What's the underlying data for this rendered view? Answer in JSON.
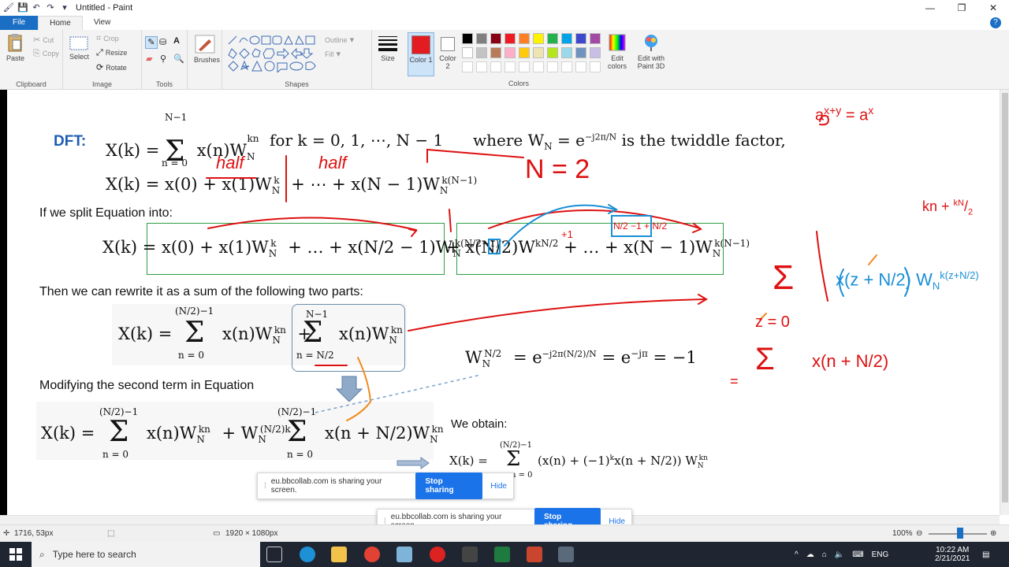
{
  "window": {
    "title": "Untitled - Paint"
  },
  "tabs": {
    "file": "File",
    "home": "Home",
    "view": "View"
  },
  "ribbon": {
    "clipboard": {
      "paste": "Paste",
      "cut": "Cut",
      "copy": "Copy",
      "label": "Clipboard"
    },
    "image": {
      "select": "Select",
      "crop": "Crop",
      "resize": "Resize",
      "rotate": "Rotate",
      "label": "Image"
    },
    "tools": {
      "label": "Tools"
    },
    "brushes": {
      "label": "Brushes"
    },
    "shapes": {
      "outline": "Outline",
      "fill": "Fill",
      "label": "Shapes"
    },
    "size": {
      "label": "Size"
    },
    "color1": {
      "label": "Color 1",
      "value": "#e31b23"
    },
    "color2": {
      "label": "Color 2",
      "value": "#ffffff"
    },
    "colors": {
      "label": "Colors"
    },
    "edit_colors": "Edit colors",
    "paint3d": "Edit with Paint 3D",
    "palette": [
      "#000000",
      "#7f7f7f",
      "#880015",
      "#ed1c24",
      "#ff7f27",
      "#fff200",
      "#22b14c",
      "#00a2e8",
      "#3f48cc",
      "#a349a4",
      "#ffffff",
      "#c3c3c3",
      "#b97a57",
      "#ffaec9",
      "#ffc90e",
      "#efe4b0",
      "#b5e61d",
      "#99d9ea",
      "#7092be",
      "#c8bfe7"
    ]
  },
  "content": {
    "dft_label": "DFT:",
    "eq1": "X(k) = Σ x(n)W",
    "eq1_sum_top": "N−1",
    "eq1_sum_bottom": "n = 0",
    "eq1_for": "for   k = 0, 1, ⋯, N − 1",
    "eq1_where": "where W",
    "eq1_twiddle": "is the twiddle factor,",
    "eq2": "X(k) = x(0) + x(1)W",
    "eq2_rest": "+ ⋯ + x(N − 1)W",
    "split_text": "If we split Equation into:",
    "eq3_left": "X(k) = x(0) + x(1)W",
    "eq3_mid": "+ … + x",
    "eq3_right": "+ x",
    "eq3_right2": "W",
    "eq3_right3": "+ … + x(N − 1)W",
    "rewrite_text": "Then we can rewrite it as a sum of the following two parts:",
    "eq4": "X(k) =",
    "eq4_sum1_top": "(N/2)−1",
    "eq4_sum1_bottom": "n = 0",
    "eq4_term1": "x(n)W",
    "eq4_plus": "+",
    "eq4_sum2_top": "N−1",
    "eq4_sum2_bottom": "n = N/2",
    "eq4_term2": "x(n)W",
    "wn2": "W",
    "wn2_rest": "= e",
    "wn2_rest2": "= e",
    "wn2_value": "= −1",
    "modify_text": "Modifying the second term in Equation",
    "eq5": "X(k) =",
    "eq5_sum1_top": "(N/2)−1",
    "eq5_sum1_bottom": "n = 0",
    "eq5_term1": "x(n)W",
    "eq5_plus": "+ W",
    "eq5_sum2_top": "(N/2)−1",
    "eq5_sum2_bottom": "n = 0",
    "eq5_term2": "x",
    "eq5_term2b": "W",
    "obtain_text": "We obtain:",
    "eq6": "X(k) =",
    "eq6_sum_top": "(N/2)−1",
    "eq6_sum_bottom": "n = 0",
    "eq6_term": "x(n) + (−1)",
    "eq6_term_b": "x",
    "eq6_term_c": "W",
    "hw_half1": "half",
    "hw_half2": "half",
    "hw_n2": "N = 2",
    "hw_exp": "a",
    "hw_eq0": "= 0",
    "hw_np1": "+1",
    "hw_np1b": "+1"
  },
  "share": {
    "message": "eu.bbcollab.com is sharing your screen.",
    "stop": "Stop sharing",
    "hide": "Hide"
  },
  "status": {
    "cursor": "1716, 53px",
    "dimensions": "1920 × 1080px",
    "zoom": "100%"
  },
  "taskbar": {
    "search_placeholder": "Type here to search",
    "lang": "ENG",
    "time": "10:22 AM",
    "date": "2/21/2021"
  }
}
